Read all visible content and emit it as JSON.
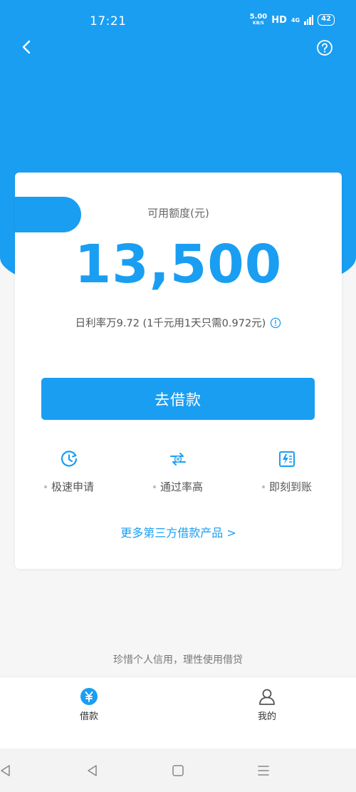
{
  "status": {
    "time": "17:21",
    "speed_value": "5.00",
    "speed_unit": "KB/S",
    "hd": "HD",
    "network": "4G",
    "battery": "42"
  },
  "card": {
    "label": "可用额度(元)",
    "amount": "13,500",
    "rate_text": "日利率万9.72 (1千元用1天只需0.972元)",
    "borrow_button": "去借款",
    "features": [
      {
        "icon": "clock-icon",
        "label": "极速申请"
      },
      {
        "icon": "exchange-icon",
        "label": "通过率高"
      },
      {
        "icon": "bolt-icon",
        "label": "即刻到账"
      }
    ],
    "more_link": "更多第三方借款产品 >"
  },
  "slogan": "珍惜个人信用，理性使用借贷",
  "tabs": [
    {
      "label": "借款",
      "icon": "yuan-icon",
      "active": true
    },
    {
      "label": "我的",
      "icon": "user-icon",
      "active": false
    }
  ],
  "colors": {
    "accent": "#1a9ef2",
    "text_muted": "#555555",
    "background": "#f6f6f6"
  }
}
